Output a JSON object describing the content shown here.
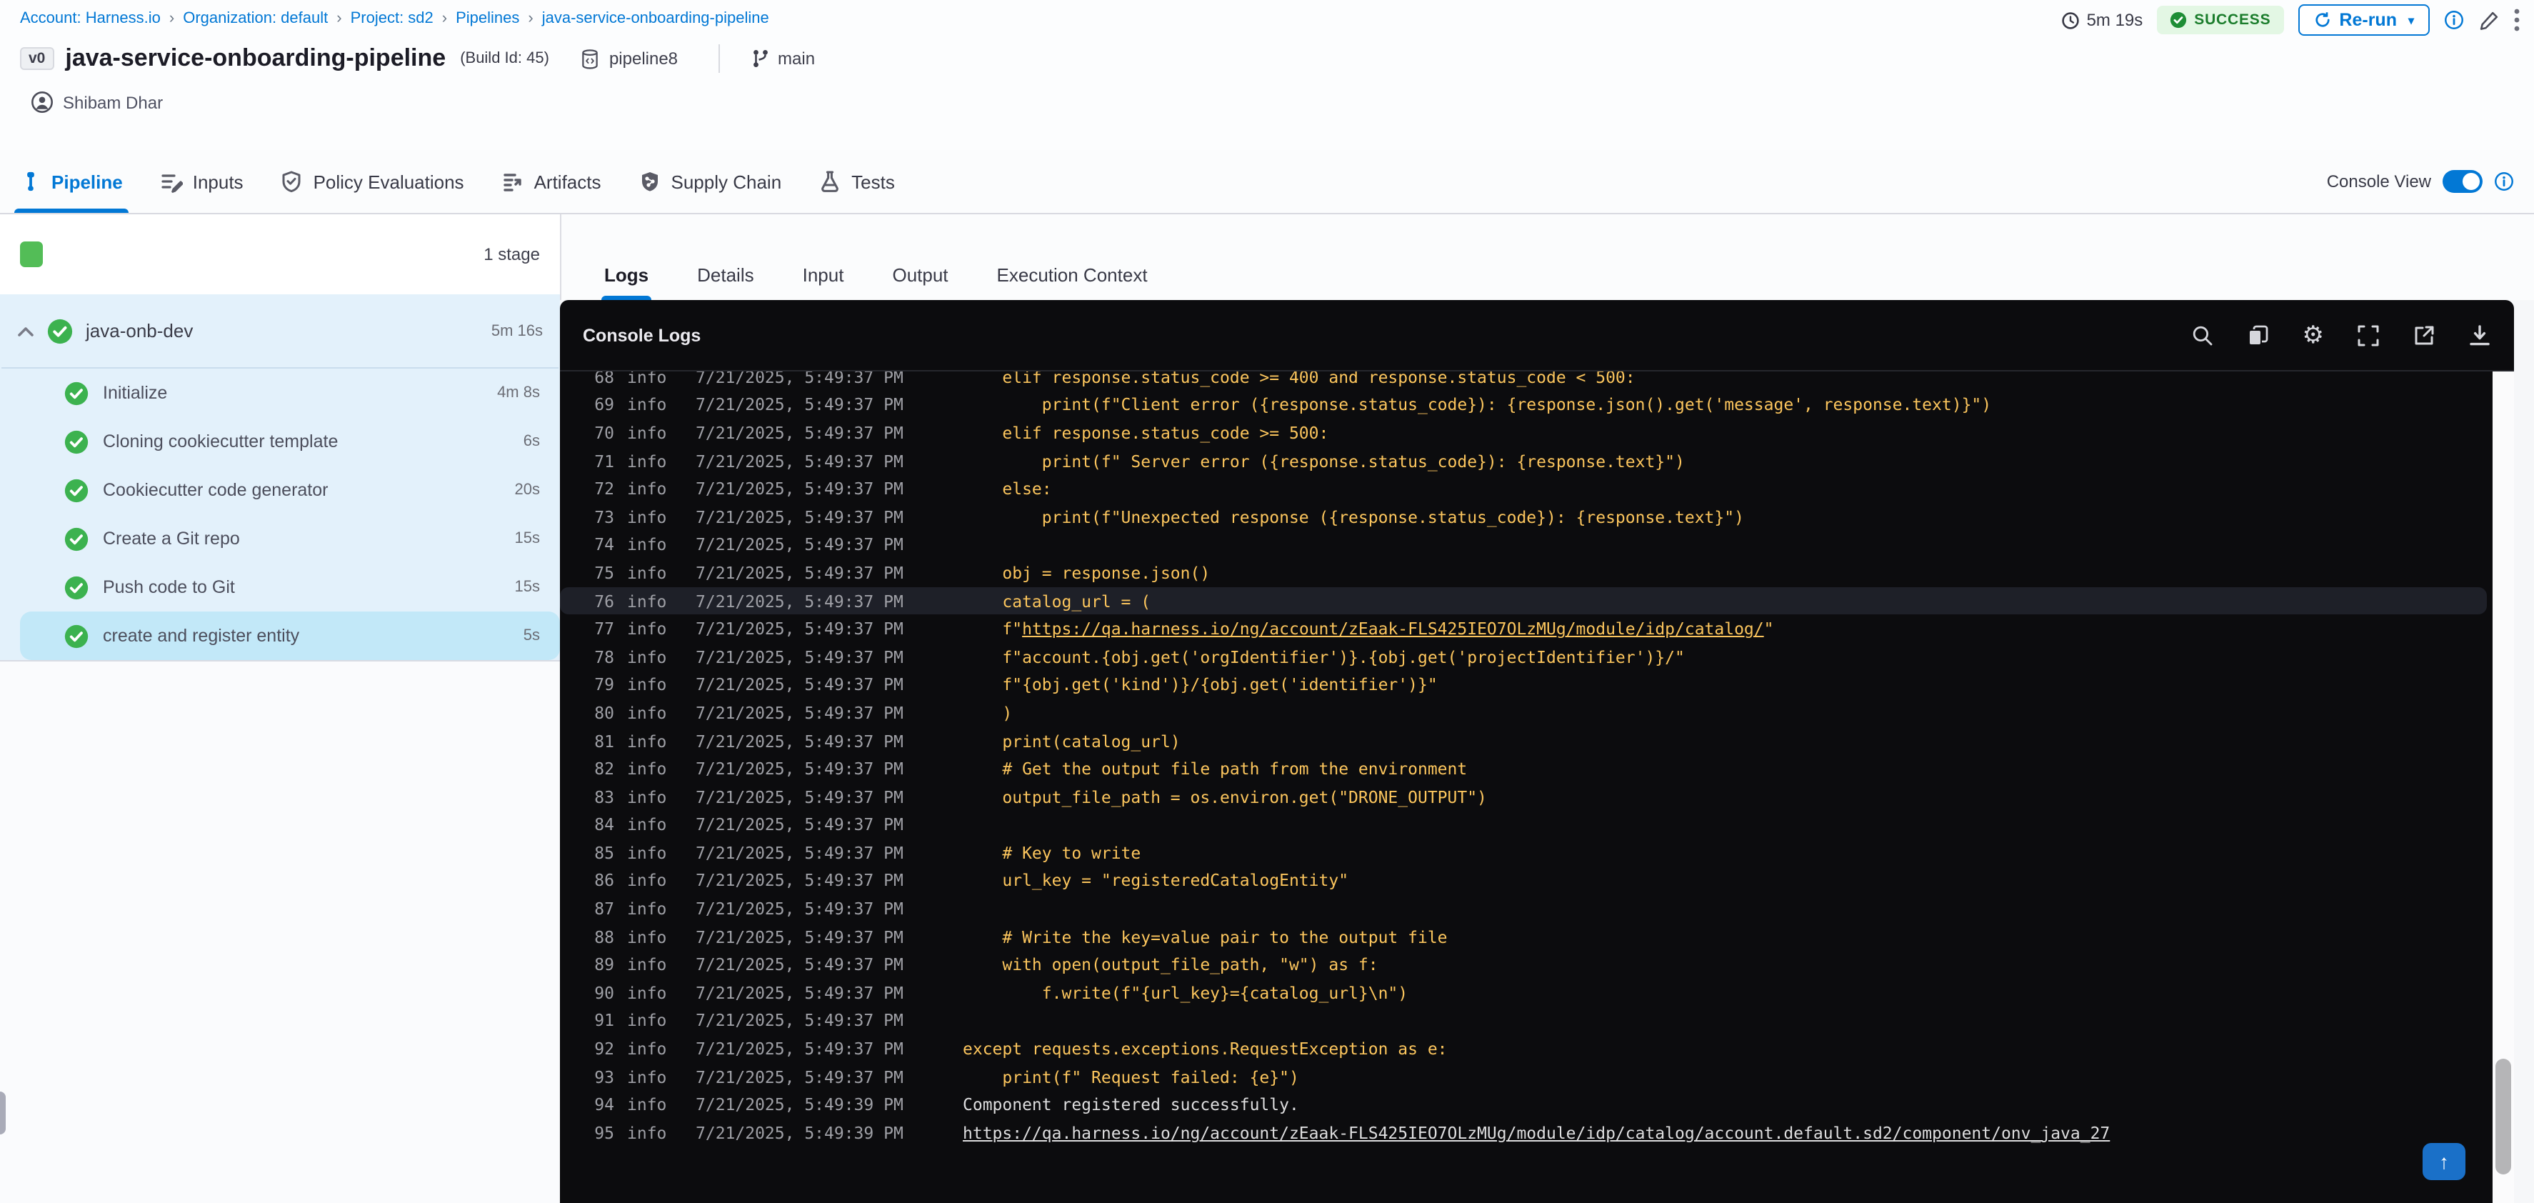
{
  "colors": {
    "accent_blue": "#0278d5",
    "success_green": "#1b7d2c",
    "check_green": "#3cb24f",
    "stage_square_green": "#53bd57",
    "sidebar_blue": "#e3f1fb",
    "selected_step_blue": "#c2e8f8",
    "console_bg": "#0c0c0e",
    "log_code_yellow": "#fbc55d",
    "log_output_white": "#dededf",
    "log_meta_gray": "#9fa0a6"
  },
  "breadcrumb": {
    "separator": "›",
    "items": [
      "Account: Harness.io",
      "Organization: default",
      "Project: sd2",
      "Pipelines",
      "java-service-onboarding-pipeline"
    ]
  },
  "header": {
    "version_badge": "v0",
    "title": "java-service-onboarding-pipeline",
    "build_label": "(Build Id: 45)",
    "repo_name": "pipeline8",
    "branch_name": "main",
    "author": "Shibam Dhar",
    "duration": "5m 19s",
    "status_label": "SUCCESS",
    "rerun_label": "Re-run",
    "rerun_caret": "▾"
  },
  "tabbar": {
    "tabs": [
      {
        "label": "Pipeline",
        "icon": "pipeline-icon",
        "active": true
      },
      {
        "label": "Inputs",
        "icon": "inputs-icon",
        "active": false
      },
      {
        "label": "Policy Evaluations",
        "icon": "policy-shield-icon",
        "active": false
      },
      {
        "label": "Artifacts",
        "icon": "artifacts-icon",
        "active": false
      },
      {
        "label": "Supply Chain",
        "icon": "supply-chain-icon",
        "active": false
      },
      {
        "label": "Tests",
        "icon": "tests-flask-icon",
        "active": false
      }
    ],
    "console_view_label": "Console View",
    "console_view_on": true
  },
  "sidebar": {
    "stage_count_label": "1 stage",
    "stage": {
      "name": "java-onb-dev",
      "duration": "5m 16s"
    },
    "steps": [
      {
        "name": "Initialize",
        "duration": "4m 8s",
        "selected": false
      },
      {
        "name": "Cloning cookiecutter template",
        "duration": "6s",
        "selected": false
      },
      {
        "name": "Cookiecutter code generator",
        "duration": "20s",
        "selected": false
      },
      {
        "name": "Create a Git repo",
        "duration": "15s",
        "selected": false
      },
      {
        "name": "Push code to Git",
        "duration": "15s",
        "selected": false
      },
      {
        "name": "create and register entity",
        "duration": "5s",
        "selected": true
      }
    ]
  },
  "log_panel": {
    "tabs": [
      "Logs",
      "Details",
      "Input",
      "Output",
      "Execution Context"
    ],
    "active_tab": "Logs",
    "console_title": "Console Logs",
    "toolbar_icons": [
      "search-icon",
      "copy-icon",
      "settings-gear-icon",
      "fullscreen-icon",
      "open-in-new-icon",
      "download-icon"
    ],
    "scroll_top_arrow": "↑"
  },
  "logs": {
    "default_timestamp": "7/21/2025, 5:49:37 PM",
    "lines": [
      {
        "n": 68,
        "level": "info",
        "ts": "7/21/2025, 5:49:37 PM",
        "msg": "    elif response.status_code >= 400 and response.status_code < 500:"
      },
      {
        "n": 69,
        "level": "info",
        "ts": "7/21/2025, 5:49:37 PM",
        "msg": "        print(f\"Client error ({response.status_code}): {response.json().get('message', response.text)}\")"
      },
      {
        "n": 70,
        "level": "info",
        "ts": "7/21/2025, 5:49:37 PM",
        "msg": "    elif response.status_code >= 500:"
      },
      {
        "n": 71,
        "level": "info",
        "ts": "7/21/2025, 5:49:37 PM",
        "msg": "        print(f\" Server error ({response.status_code}): {response.text}\")"
      },
      {
        "n": 72,
        "level": "info",
        "ts": "7/21/2025, 5:49:37 PM",
        "msg": "    else:"
      },
      {
        "n": 73,
        "level": "info",
        "ts": "7/21/2025, 5:49:37 PM",
        "msg": "        print(f\"Unexpected response ({response.status_code}): {response.text}\")"
      },
      {
        "n": 74,
        "level": "info",
        "ts": "7/21/2025, 5:49:37 PM",
        "msg": ""
      },
      {
        "n": 75,
        "level": "info",
        "ts": "7/21/2025, 5:49:37 PM",
        "msg": "    obj = response.json()"
      },
      {
        "n": 76,
        "level": "info",
        "ts": "7/21/2025, 5:49:37 PM",
        "msg": "    catalog_url = (",
        "highlight": true
      },
      {
        "n": 77,
        "level": "info",
        "ts": "7/21/2025, 5:49:37 PM",
        "msg_pre": "    f\"",
        "msg_link": "https://qa.harness.io/ng/account/zEaak-FLS425IEO7OLzMUg/module/idp/catalog/",
        "msg_post": "\""
      },
      {
        "n": 78,
        "level": "info",
        "ts": "7/21/2025, 5:49:37 PM",
        "msg": "    f\"account.{obj.get('orgIdentifier')}.{obj.get('projectIdentifier')}/\""
      },
      {
        "n": 79,
        "level": "info",
        "ts": "7/21/2025, 5:49:37 PM",
        "msg": "    f\"{obj.get('kind')}/{obj.get('identifier')}\""
      },
      {
        "n": 80,
        "level": "info",
        "ts": "7/21/2025, 5:49:37 PM",
        "msg": "    )"
      },
      {
        "n": 81,
        "level": "info",
        "ts": "7/21/2025, 5:49:37 PM",
        "msg": "    print(catalog_url)"
      },
      {
        "n": 82,
        "level": "info",
        "ts": "7/21/2025, 5:49:37 PM",
        "msg": "    # Get the output file path from the environment"
      },
      {
        "n": 83,
        "level": "info",
        "ts": "7/21/2025, 5:49:37 PM",
        "msg": "    output_file_path = os.environ.get(\"DRONE_OUTPUT\")"
      },
      {
        "n": 84,
        "level": "info",
        "ts": "7/21/2025, 5:49:37 PM",
        "msg": ""
      },
      {
        "n": 85,
        "level": "info",
        "ts": "7/21/2025, 5:49:37 PM",
        "msg": "    # Key to write"
      },
      {
        "n": 86,
        "level": "info",
        "ts": "7/21/2025, 5:49:37 PM",
        "msg": "    url_key = \"registeredCatalogEntity\""
      },
      {
        "n": 87,
        "level": "info",
        "ts": "7/21/2025, 5:49:37 PM",
        "msg": ""
      },
      {
        "n": 88,
        "level": "info",
        "ts": "7/21/2025, 5:49:37 PM",
        "msg": "    # Write the key=value pair to the output file"
      },
      {
        "n": 89,
        "level": "info",
        "ts": "7/21/2025, 5:49:37 PM",
        "msg": "    with open(output_file_path, \"w\") as f:"
      },
      {
        "n": 90,
        "level": "info",
        "ts": "7/21/2025, 5:49:37 PM",
        "msg": "        f.write(f\"{url_key}={catalog_url}\\n\")"
      },
      {
        "n": 91,
        "level": "info",
        "ts": "7/21/2025, 5:49:37 PM",
        "msg": ""
      },
      {
        "n": 92,
        "level": "info",
        "ts": "7/21/2025, 5:49:37 PM",
        "msg": "except requests.exceptions.RequestException as e:"
      },
      {
        "n": 93,
        "level": "info",
        "ts": "7/21/2025, 5:49:37 PM",
        "msg": "    print(f\" Request failed: {e}\")"
      },
      {
        "n": 94,
        "level": "info",
        "ts": "7/21/2025, 5:49:39 PM",
        "msg": "Component registered successfully.",
        "kind": "output"
      },
      {
        "n": 95,
        "level": "info",
        "ts": "7/21/2025, 5:49:39 PM",
        "msg_pre": "",
        "msg_link": "https://qa.harness.io/ng/account/zEaak-FLS425IEO7OLzMUg/module/idp/catalog/account.default.sd2/component/onv_java_27",
        "msg_post": "",
        "kind": "output"
      }
    ]
  }
}
